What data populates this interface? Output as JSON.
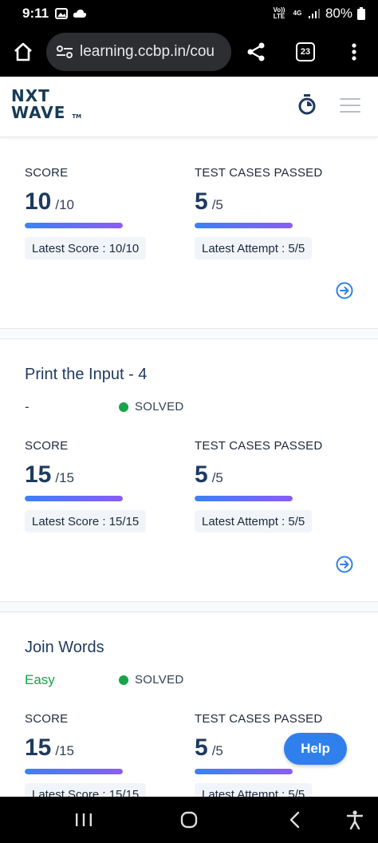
{
  "status_bar": {
    "time": "9:11",
    "volte": "Vo)) LTE",
    "net": "4G",
    "battery": "80%"
  },
  "browser": {
    "url": "learning.ccbp.in/cou",
    "tab_count": "23"
  },
  "app": {
    "logo_line1": "NXT",
    "logo_line2": "WAVE",
    "logo_tm": "TM"
  },
  "problems": [
    {
      "title": "",
      "difficulty": "",
      "status": "",
      "score_label": "SCORE",
      "score": "10",
      "score_max": "/10",
      "score_fraction": 1.0,
      "tests_label": "TEST CASES PASSED",
      "tests": "5",
      "tests_max": "/5",
      "tests_fraction": 1.0,
      "latest_score": "Latest Score : 10/10",
      "latest_attempt": "Latest Attempt : 5/5"
    },
    {
      "title": "Print the Input - 4",
      "difficulty": "-",
      "status": "SOLVED",
      "score_label": "SCORE",
      "score": "15",
      "score_max": "/15",
      "score_fraction": 1.0,
      "tests_label": "TEST CASES PASSED",
      "tests": "5",
      "tests_max": "/5",
      "tests_fraction": 1.0,
      "latest_score": "Latest Score : 15/15",
      "latest_attempt": "Latest Attempt : 5/5"
    },
    {
      "title": "Join Words",
      "difficulty": "Easy",
      "status": "SOLVED",
      "score_label": "SCORE",
      "score": "15",
      "score_max": "/15",
      "score_fraction": 1.0,
      "tests_label": "TEST CASES PASSED",
      "tests": "5",
      "tests_max": "/5",
      "tests_fraction": 1.0,
      "latest_score": "Latest Score : 15/15",
      "latest_attempt": "Latest Attempt : 5/5"
    }
  ],
  "help_label": "Help",
  "colors": {
    "accent": "#2f80ed",
    "easy": "#16a34a",
    "solved_dot": "#16a34a",
    "title": "#1e3a5f"
  }
}
